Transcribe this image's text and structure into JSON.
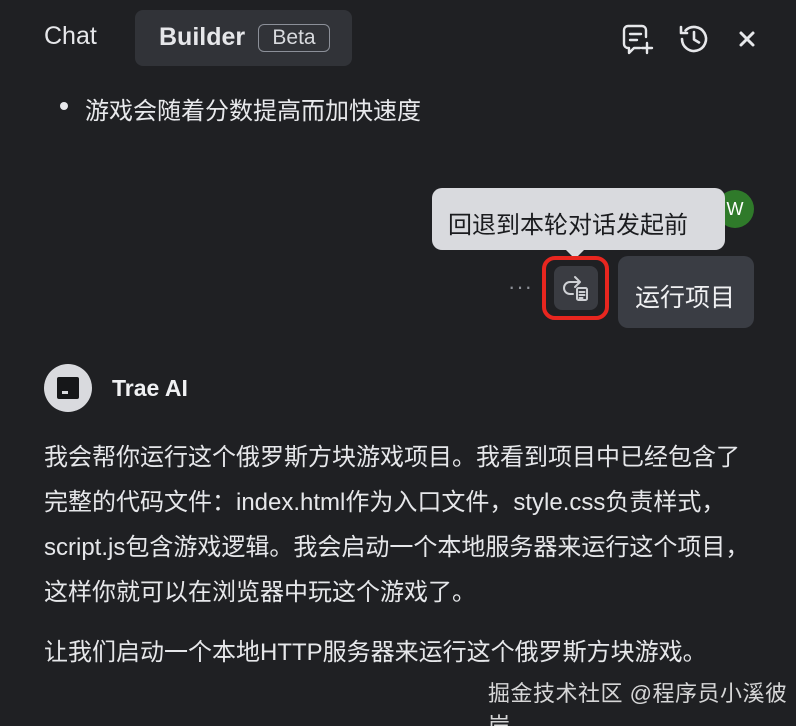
{
  "header": {
    "tab_chat": "Chat",
    "tab_builder": "Builder",
    "beta_badge": "Beta",
    "icons": [
      "new-chat-icon",
      "history-icon",
      "close-icon"
    ]
  },
  "previous_message": {
    "bullet": "游戏会随着分数提高而加快速度"
  },
  "user_message": {
    "avatar_letter": "W",
    "text": "运行项目",
    "tooltip": "回退到本轮对话发起前",
    "more": "···"
  },
  "ai_message": {
    "name": "Trae AI",
    "paragraph1": "我会帮你运行这个俄罗斯方块游戏项目。我看到项目中已经包含了完整的代码文件：index.html作为入口文件，style.css负责样式，script.js包含游戏逻辑。我会启动一个本地服务器来运行这个项目，这样你就可以在浏览器中玩这个游戏了。",
    "paragraph2": "让我们启动一个本地HTTP服务器来运行这个俄罗斯方块游戏。"
  },
  "watermark": "掘金技术社区 @程序员小溪彼岸",
  "colors": {
    "background": "#1f2023",
    "highlight_border": "#e8261f",
    "avatar_green": "#2f7a2a"
  }
}
